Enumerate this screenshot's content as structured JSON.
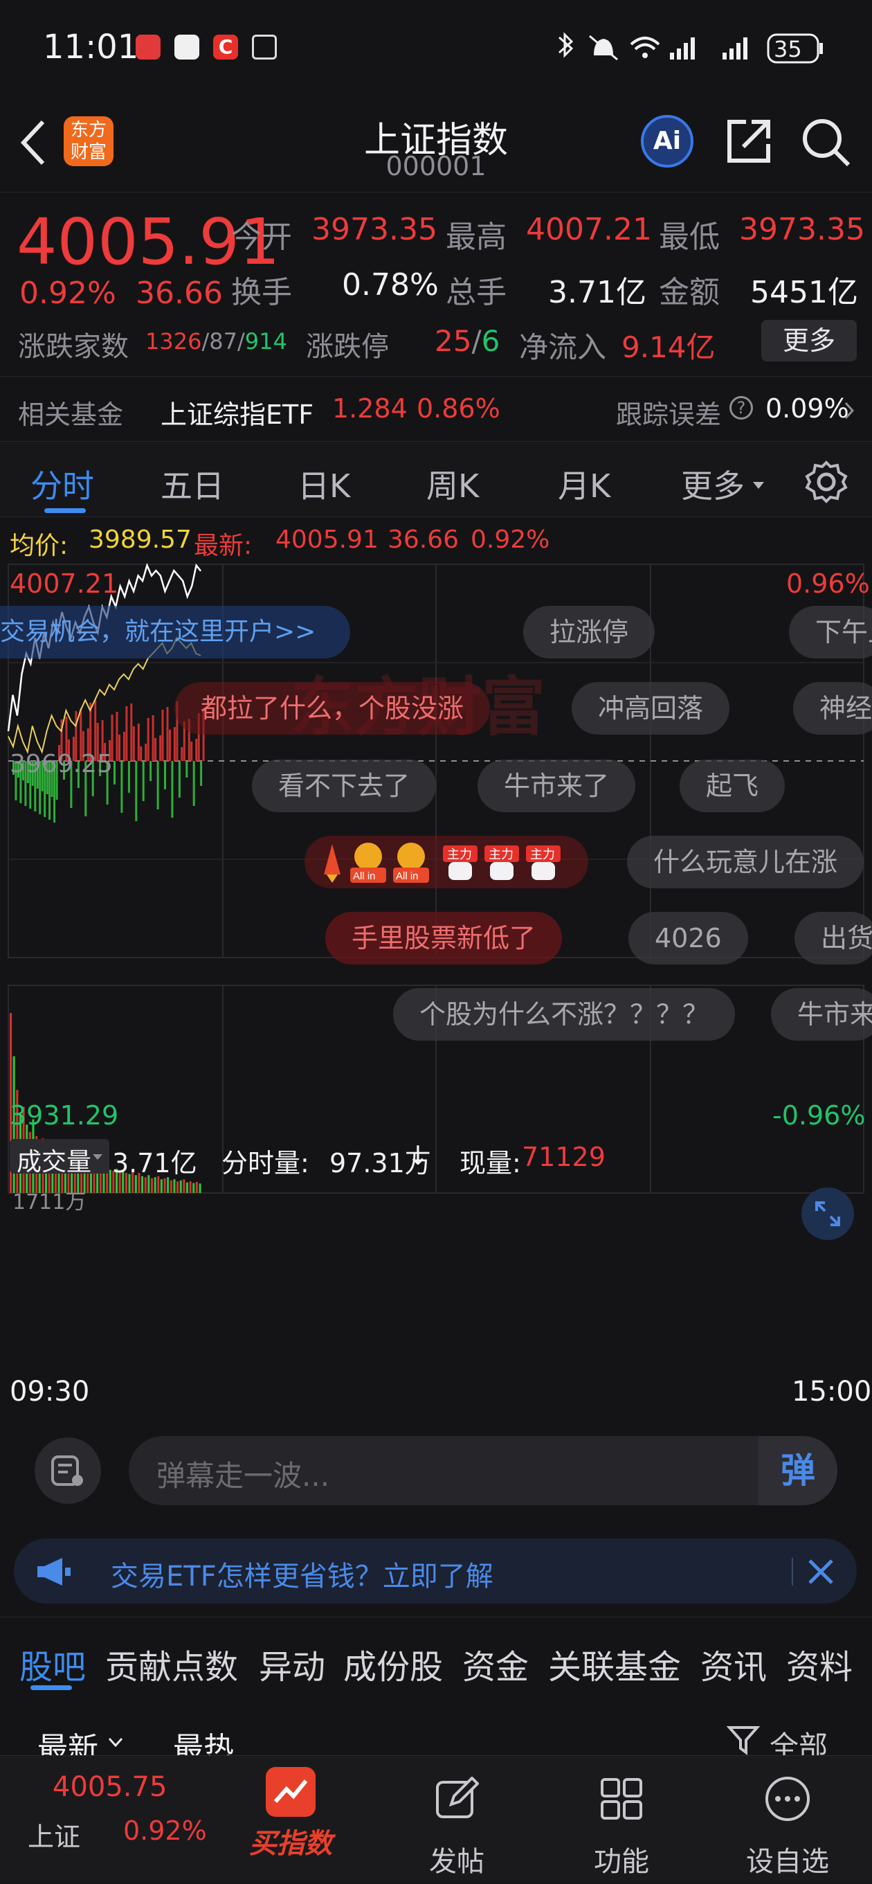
{
  "status_bar": {
    "time": "11:01",
    "battery": "35"
  },
  "header": {
    "title": "上证指数",
    "code": "000001"
  },
  "quote": {
    "price": "4005.91",
    "pct": "0.92%",
    "change": "36.66",
    "open_label": "今开",
    "open": "3973.35",
    "high_label": "最高",
    "high": "4007.21",
    "low_label": "最低",
    "low": "3973.35",
    "turnover_label": "换手",
    "turnover": "0.78%",
    "volume_label": "总手",
    "volume": "3.71亿",
    "amount_label": "金额",
    "amount": "5451亿",
    "breadth_label": "涨跌家数",
    "up": "1326",
    "flat": "87",
    "down": "914",
    "limit_label": "涨跌停",
    "limit_up": "25",
    "limit_down": "6",
    "flow_label": "净流入",
    "flow": "9.14亿",
    "more_button": "更多"
  },
  "fund": {
    "label": "相关基金",
    "name": "上证综指ETF",
    "price": "1.284",
    "pct": "0.86%",
    "err_label": "跟踪误差",
    "err": "0.09%"
  },
  "tabs": [
    "分时",
    "五日",
    "日K",
    "周K",
    "月K",
    "更多"
  ],
  "chart": {
    "avg_label": "均价:",
    "avg": "3989.57",
    "latest_label": "最新:",
    "latest": "4005.91",
    "latest_change": "36.66",
    "latest_pct": "0.92%",
    "y_top": "4007.21",
    "y_top_pct": "0.96%",
    "y_mid": "3969.25",
    "y_bottom": "3931.29",
    "y_bottom_pct": "-0.96%",
    "watermark": "东方财富",
    "vol_label": "成交量",
    "vol": "3.71亿",
    "minute_vol_label": "分时量:",
    "minute_vol": "97.31万",
    "now_vol_label": "现量:",
    "now_vol": "71129",
    "vol_max": "1711万",
    "time_start": "09:30",
    "time_end": "15:00",
    "open_account": "交易机会，就在这里开户>>"
  },
  "chart_data": {
    "type": "line",
    "title": "",
    "xlabel": "",
    "ylabel": "",
    "x_range": [
      "09:30",
      "15:00"
    ],
    "ylim": [
      3931.29,
      4007.21
    ],
    "prev_close": 3969.25,
    "series": [
      {
        "values": [
          3975,
          3982,
          3978,
          3986,
          3990,
          3988,
          3993,
          3989,
          3994,
          3991,
          3996,
          3994,
          3998,
          3995,
          3993,
          3996,
          3994,
          3997,
          3999,
          3996,
          3994,
          3999,
          3997,
          4001,
          3999,
          4003,
          4001,
          4004,
          4002,
          4005,
          4004,
          4007,
          4005,
          4006,
          4005,
          4002,
          4004,
          4006,
          4005,
          4004,
          4001,
          4003,
          4007,
          4005.91
        ]
      },
      {
        "values": [
          3974,
          3972,
          3976,
          3973,
          3971,
          3976,
          3973,
          3971,
          3975,
          3978,
          3976,
          3975,
          3979,
          3977,
          3976,
          3979,
          3981,
          3979,
          3981,
          3983,
          3982,
          3984,
          3983,
          3985,
          3986,
          3985,
          3987,
          3988,
          3987,
          3989,
          3990,
          3991,
          3992,
          3990,
          3991,
          3993,
          3992,
          3991,
          3992,
          3990,
          3989.57
        ]
      }
    ],
    "volume_ylim": [
      0,
      1711
    ],
    "volume_values": [
      1711,
      1300,
      980,
      760,
      820,
      650,
      580,
      700,
      540,
      480,
      520,
      460,
      430,
      500,
      410,
      380,
      420,
      360,
      340,
      390,
      320,
      300,
      330,
      280,
      270,
      300,
      260,
      250,
      240,
      260,
      230,
      220,
      210,
      230,
      200,
      210,
      190,
      180,
      200,
      170,
      190,
      160,
      150,
      170,
      140,
      150,
      160,
      130,
      140,
      150,
      120,
      130,
      110,
      120,
      130,
      100,
      110,
      95,
      105,
      90
    ]
  },
  "danmu": [
    {
      "text": "拉涨停",
      "style": "gray"
    },
    {
      "text": "下午上",
      "style": "gray"
    },
    {
      "text": "都拉了什么，个股没涨",
      "style": "red"
    },
    {
      "text": "冲高回落",
      "style": "gray"
    },
    {
      "text": "神经",
      "style": "gray"
    },
    {
      "text": "看不下去了",
      "style": "gray"
    },
    {
      "text": "牛市来了",
      "style": "gray"
    },
    {
      "text": "起飞",
      "style": "gray"
    },
    {
      "text": "什么玩意儿在涨",
      "style": "gray"
    },
    {
      "text": "手里股票新低了",
      "style": "red"
    },
    {
      "text": "4026",
      "style": "gray"
    },
    {
      "text": "出货",
      "style": "gray"
    },
    {
      "text": "个股为什么不涨？？？？",
      "style": "gray"
    },
    {
      "text": "牛市来",
      "style": "gray"
    }
  ],
  "danmu_icons": {
    "allin": "All in",
    "zhuli": "主力"
  },
  "comment": {
    "placeholder": "弹幕走一波...",
    "send": "弹"
  },
  "ad": {
    "text": "交易ETF怎样更省钱？立即了解"
  },
  "guba_tabs": [
    "股吧",
    "贡献点数",
    "异动",
    "成份股",
    "资金",
    "关联基金",
    "资讯",
    "资料"
  ],
  "sort": {
    "latest": "最新",
    "hot": "最热",
    "filter": "全部"
  },
  "bottom": {
    "price": "4005.75",
    "name": "上证",
    "pct": "0.92%",
    "buy": "买指数",
    "post": "发帖",
    "func": "功能",
    "watch": "设自选"
  }
}
